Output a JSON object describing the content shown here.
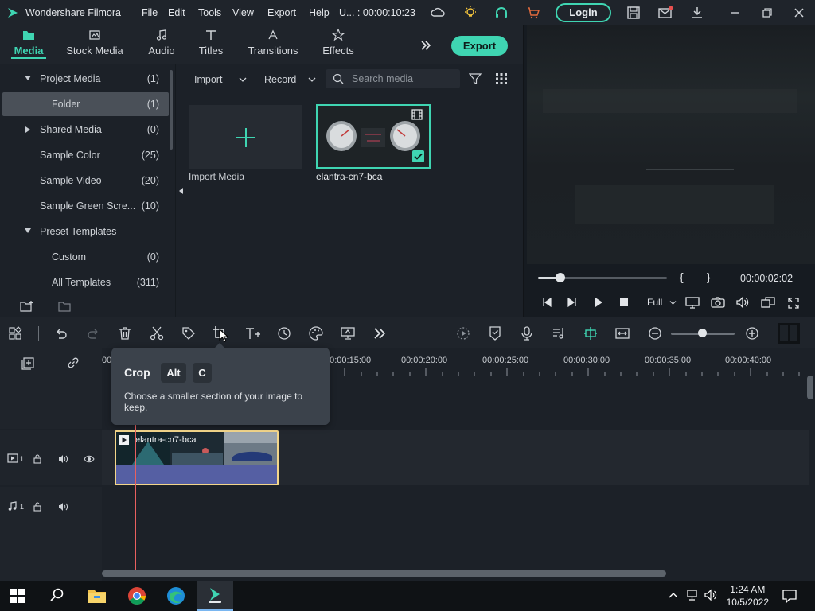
{
  "app": {
    "title": "Wondershare Filmora",
    "menu": [
      "File",
      "Edit",
      "Tools",
      "View",
      "Export",
      "Help"
    ],
    "project_status": "U... : 00:00:10:23",
    "login_label": "Login"
  },
  "media_tabs": [
    {
      "label": "Media",
      "icon": "media-folder-icon",
      "active": true
    },
    {
      "label": "Stock Media",
      "icon": "stock-media-icon",
      "active": false
    },
    {
      "label": "Audio",
      "icon": "audio-note-icon",
      "active": false
    },
    {
      "label": "Titles",
      "icon": "titles-t-icon",
      "active": false
    },
    {
      "label": "Transitions",
      "icon": "transitions-icon",
      "active": false
    },
    {
      "label": "Effects",
      "icon": "effects-icon",
      "active": false
    }
  ],
  "export_label": "Export",
  "sidebar": {
    "items": [
      {
        "name": "Project Media",
        "count": "(1)",
        "expander": "down"
      },
      {
        "name": "Folder",
        "count": "(1)",
        "selected": true
      },
      {
        "name": "Shared Media",
        "count": "(0)",
        "expander": "right"
      },
      {
        "name": "Sample Color",
        "count": "(25)"
      },
      {
        "name": "Sample Video",
        "count": "(20)"
      },
      {
        "name": "Sample Green Scre...",
        "count": "(10)"
      },
      {
        "name": "Preset Templates",
        "count": "",
        "expander": "down"
      },
      {
        "name": "Custom",
        "count": "(0)"
      },
      {
        "name": "All Templates",
        "count": "(311)"
      }
    ]
  },
  "media_panel": {
    "import_label": "Import",
    "record_label": "Record",
    "search_placeholder": "Search media",
    "items": [
      {
        "label": "Import Media",
        "kind": "import"
      },
      {
        "label": "elantra-cn7-bca",
        "kind": "video",
        "selected": true
      }
    ]
  },
  "preview": {
    "timecode": "00:00:02:02",
    "quality": "Full",
    "progress": 0.17
  },
  "tooltip": {
    "title": "Crop",
    "keys": [
      "Alt",
      "C"
    ],
    "description": "Choose a smaller section of your image to keep."
  },
  "timeline": {
    "ruler_labels": [
      "00:00:15:00",
      "00:00:20:00",
      "00:00:25:00",
      "00:00:30:00",
      "00:00:35:00",
      "00:00:40:00"
    ],
    "ruler_start": "00",
    "video_track_label": "1",
    "audio_track_label": "1",
    "clip_name": "elantra-cn7-bca"
  },
  "taskbar": {
    "time": "1:24 AM",
    "date": "10/5/2022"
  },
  "colors": {
    "accent": "#3fd5b2",
    "clip_border": "#f3d68a",
    "playhead": "#e8605f"
  }
}
